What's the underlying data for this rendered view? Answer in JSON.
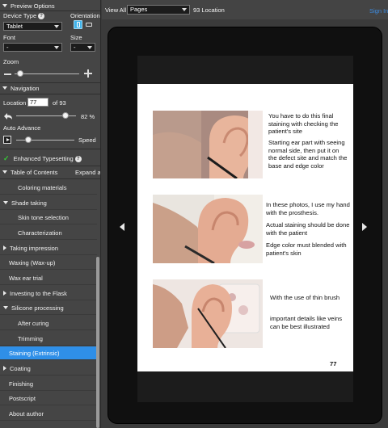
{
  "sidebar": {
    "preview_options": {
      "title": "Preview Options",
      "device_type_label": "Device Type",
      "device_type_value": "Tablet",
      "orientation_label": "Orientation",
      "font_label": "Font",
      "font_value": "-",
      "size_label": "Size",
      "size_value": "-",
      "zoom_label": "Zoom",
      "zoom_level": 0.22
    },
    "navigation": {
      "title": "Navigation",
      "location_label": "Location",
      "location_value": "77",
      "of_label": "of 93",
      "volume_percent": "82",
      "percent_sign": "%",
      "volume_level": 0.82,
      "auto_advance_label": "Auto Advance",
      "speed_label": "Speed",
      "speed_level": 0.3,
      "enhanced_label": "Enhanced Typesetting"
    },
    "toc": {
      "title": "Table of Contents",
      "expand_all": "Expand all",
      "items": [
        {
          "label": "Coloring materials"
        },
        {
          "label": "Shade taking"
        },
        {
          "label": "Skin tone selection"
        },
        {
          "label": "Characterization"
        },
        {
          "label": "Taking impression"
        },
        {
          "label": "Waxing (Wax-up)"
        },
        {
          "label": "Wax ear trial"
        },
        {
          "label": "Investing to the Flask"
        },
        {
          "label": "Silicone processing"
        },
        {
          "label": "After curing"
        },
        {
          "label": "Trimming"
        },
        {
          "label": "Staining (Extrinsic)"
        },
        {
          "label": "Coating"
        },
        {
          "label": "Finishing"
        },
        {
          "label": "Postscript"
        },
        {
          "label": "About author"
        }
      ]
    }
  },
  "toolbar": {
    "view_all": "View All",
    "pages_value": "Pages",
    "location_text": "93 Location",
    "sign_in": "Sign In"
  },
  "page": {
    "block1": [
      "You have to do this final staining with checking the patient's site",
      "Starting ear part with seeing normal side, then put it on the defect site and match the base and edge color"
    ],
    "block2": [
      "In these photos, I use my hand with the prosthesis.",
      "Actual staining should be done with the patient",
      "Edge color must blended with patient's skin"
    ],
    "block3": [
      "With the use of thin brush",
      "important details like veins can be best illustrated"
    ],
    "page_number": "77"
  },
  "colors": {
    "accent": "#2f8fe8",
    "check": "#37c837",
    "link": "#3d8be0"
  }
}
